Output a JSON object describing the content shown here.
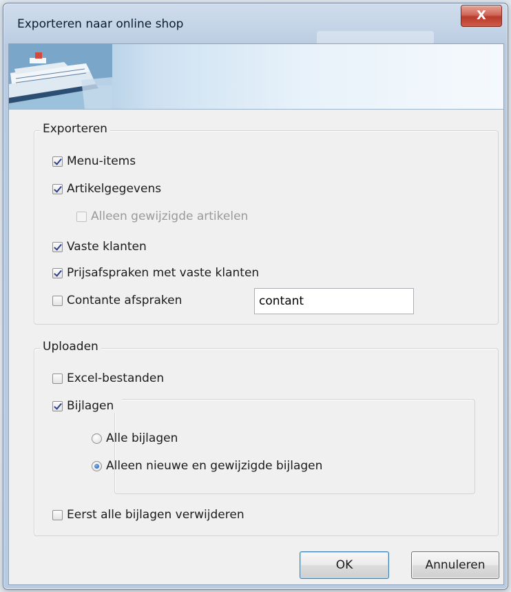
{
  "window": {
    "title": "Exporteren naar online shop",
    "close_label": "X"
  },
  "export_group": {
    "legend": "Exporteren",
    "items": [
      {
        "label": "Menu-items",
        "checked": true
      },
      {
        "label": "Artikelgegevens",
        "checked": true
      },
      {
        "label": "Alleen gewijzigde artikelen",
        "checked": false,
        "disabled": true
      },
      {
        "label": "Vaste klanten",
        "checked": true
      },
      {
        "label": "Prijsafspraken met vaste klanten",
        "checked": true
      },
      {
        "label": "Contante afspraken",
        "checked": false
      }
    ],
    "contant_value": "contant"
  },
  "upload_group": {
    "legend": "Uploaden",
    "excel_label": "Excel-bestanden",
    "excel_checked": false,
    "bijlagen_label": "Bijlagen",
    "bijlagen_checked": true,
    "radio_all": "Alle bijlagen",
    "radio_new": "Alleen nieuwe en gewijzigde bijlagen",
    "radio_selected": "new",
    "delete_label": "Eerst alle bijlagen verwijderen",
    "delete_checked": false
  },
  "buttons": {
    "ok": "OK",
    "cancel": "Annuleren"
  }
}
